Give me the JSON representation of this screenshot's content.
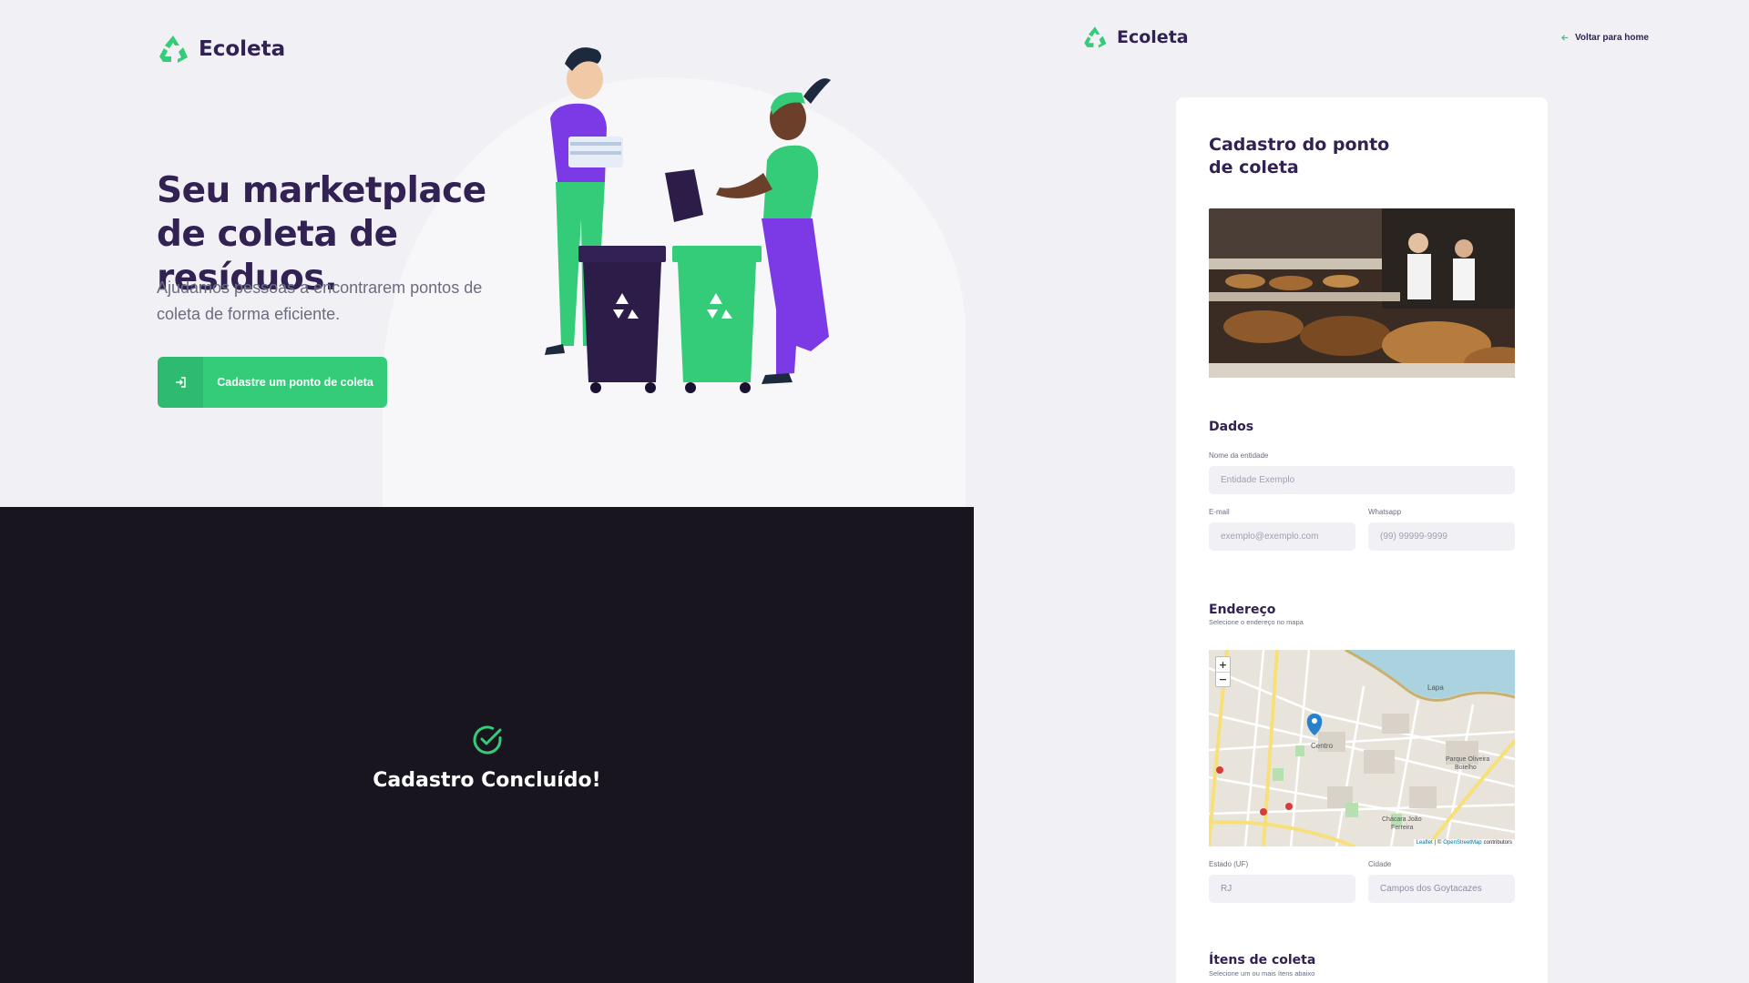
{
  "home": {
    "brand": "Ecoleta",
    "title": "Seu marketplace de coleta de resíduos.",
    "description": "Ajudamos pessoas a encontrarem pontos de coleta de forma eficiente.",
    "cta_label": "Cadastre um ponto de coleta",
    "cta_icon": "log-in-icon"
  },
  "success": {
    "title": "Cadastro Concluído!",
    "icon": "check-circle-icon"
  },
  "create_point": {
    "brand": "Ecoleta",
    "back_link": "Voltar para home",
    "form_title": "Cadastro do ponto de coleta",
    "sections": {
      "data": "Dados",
      "address": "Endereço",
      "address_sub": "Selecione o endereço no mapa",
      "items": "Ítens de coleta",
      "items_sub": "Selecione um ou mais ítens abaixo"
    },
    "fields": {
      "name_label": "Nome da entidade",
      "name_placeholder": "Entidade Exemplo",
      "email_label": "E-mail",
      "email_placeholder": "exemplo@exemplo.com",
      "whatsapp_label": "Whatsapp",
      "whatsapp_placeholder": "(99) 99999-9999",
      "uf_label": "Estado (UF)",
      "uf_value": "RJ",
      "city_label": "Cidade",
      "city_value": "Campos dos Goytacazes"
    },
    "map": {
      "zoom_in": "+",
      "zoom_out": "−",
      "attribution_leaflet": "Leaflet",
      "attribution_sep": "| ©",
      "attribution_osm": "OpenStreetMap",
      "attribution_tail": "contributors",
      "labels": [
        "Lapa",
        "Centro",
        "Parque Oliveira Botelho",
        "Chácara João Ferreira"
      ]
    }
  },
  "colors": {
    "primary": "#34cb79",
    "title": "#322153",
    "text": "#6c6c80",
    "background": "#f0f0f5",
    "overlay": "#18151f"
  }
}
